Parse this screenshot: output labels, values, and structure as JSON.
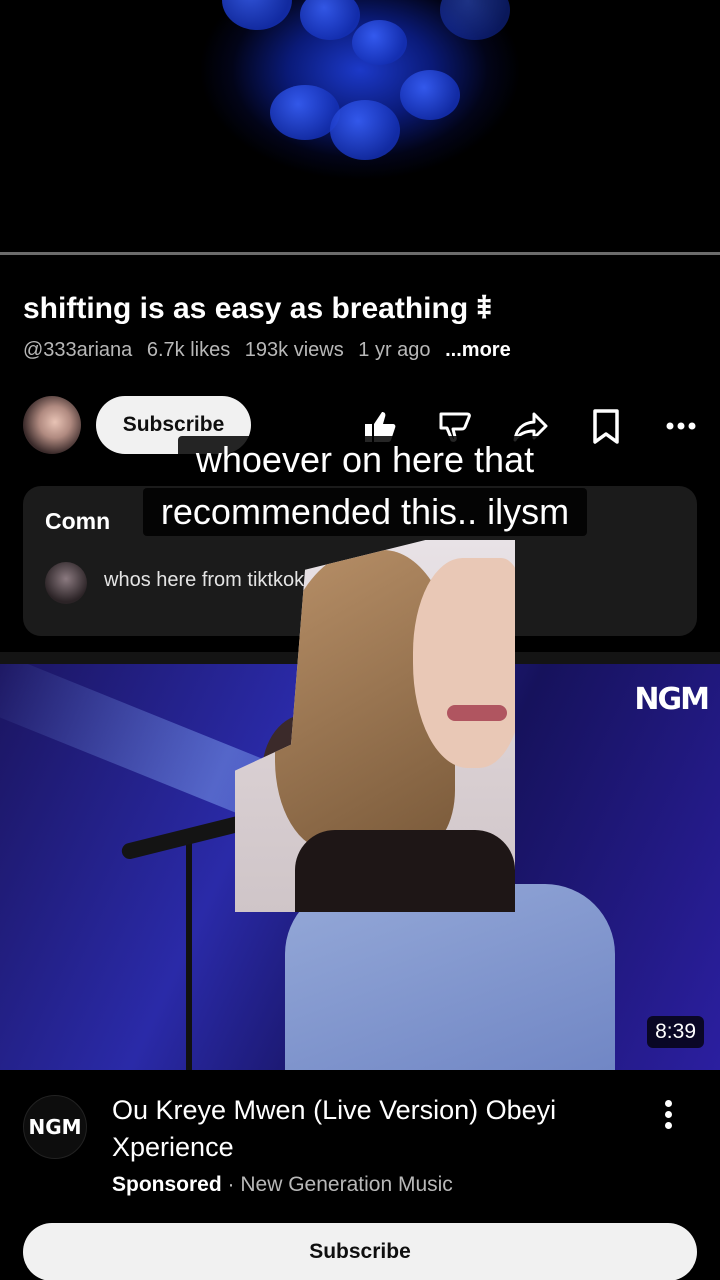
{
  "video": {
    "title": "shifting is as easy as breathing ⹋",
    "channel": "@333ariana",
    "likes": "6.7k likes",
    "views": "193k views",
    "age": "1 yr ago",
    "more": "...more",
    "subscribe": "Subscribe",
    "progress": 0.0
  },
  "actions": [
    {
      "icon": "like-icon"
    },
    {
      "icon": "dislike-icon"
    },
    {
      "icon": "share-icon"
    },
    {
      "icon": "save-icon"
    },
    {
      "icon": "more-icon"
    }
  ],
  "comments": {
    "label": "Comn",
    "top_comment": "whos here from tiktkok"
  },
  "caption": {
    "line1": "whoever on here that",
    "line2": "recommended this.. ilysm"
  },
  "ad": {
    "logo_text": "NGM",
    "duration": "8:39",
    "avatar_text": "NGM",
    "title": "Ou Kreye Mwen (Live Version) Obeyi Xperience",
    "sponsored": "Sponsored",
    "separator": "·",
    "advertiser": "New Generation Music",
    "subscribe": "Subscribe"
  }
}
